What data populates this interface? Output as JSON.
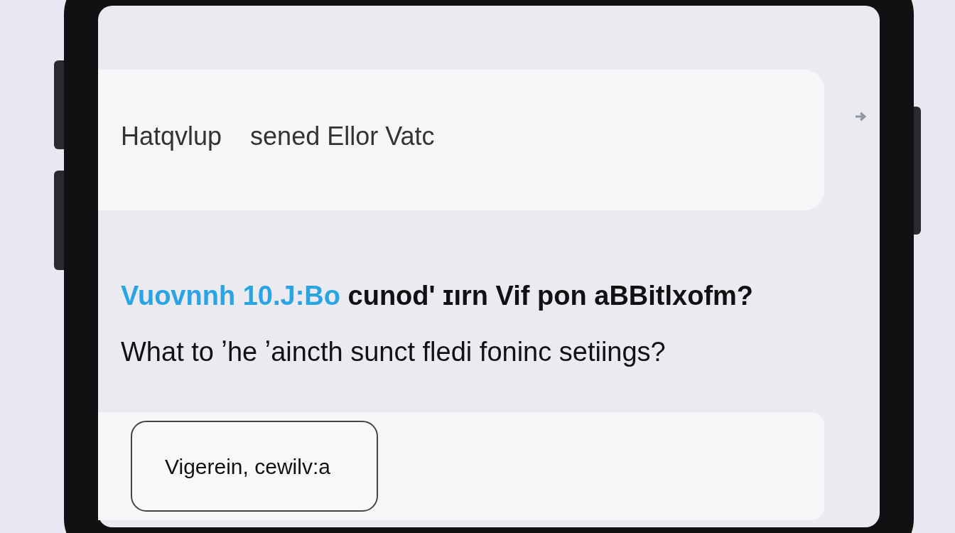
{
  "input_card": {
    "text": "Hatqvlup    sened Ellor Vatc"
  },
  "question": {
    "highlight": "Vuovnnh 10.J:Bo",
    "line_1": "cunod' ɪırn Vif pon aBBitlxofm?",
    "line_2": "What to ʼhe ʼaincth sunct fledi foninc setiings?"
  },
  "answer_card": {
    "button": "Vigerein, cewilv:a"
  }
}
